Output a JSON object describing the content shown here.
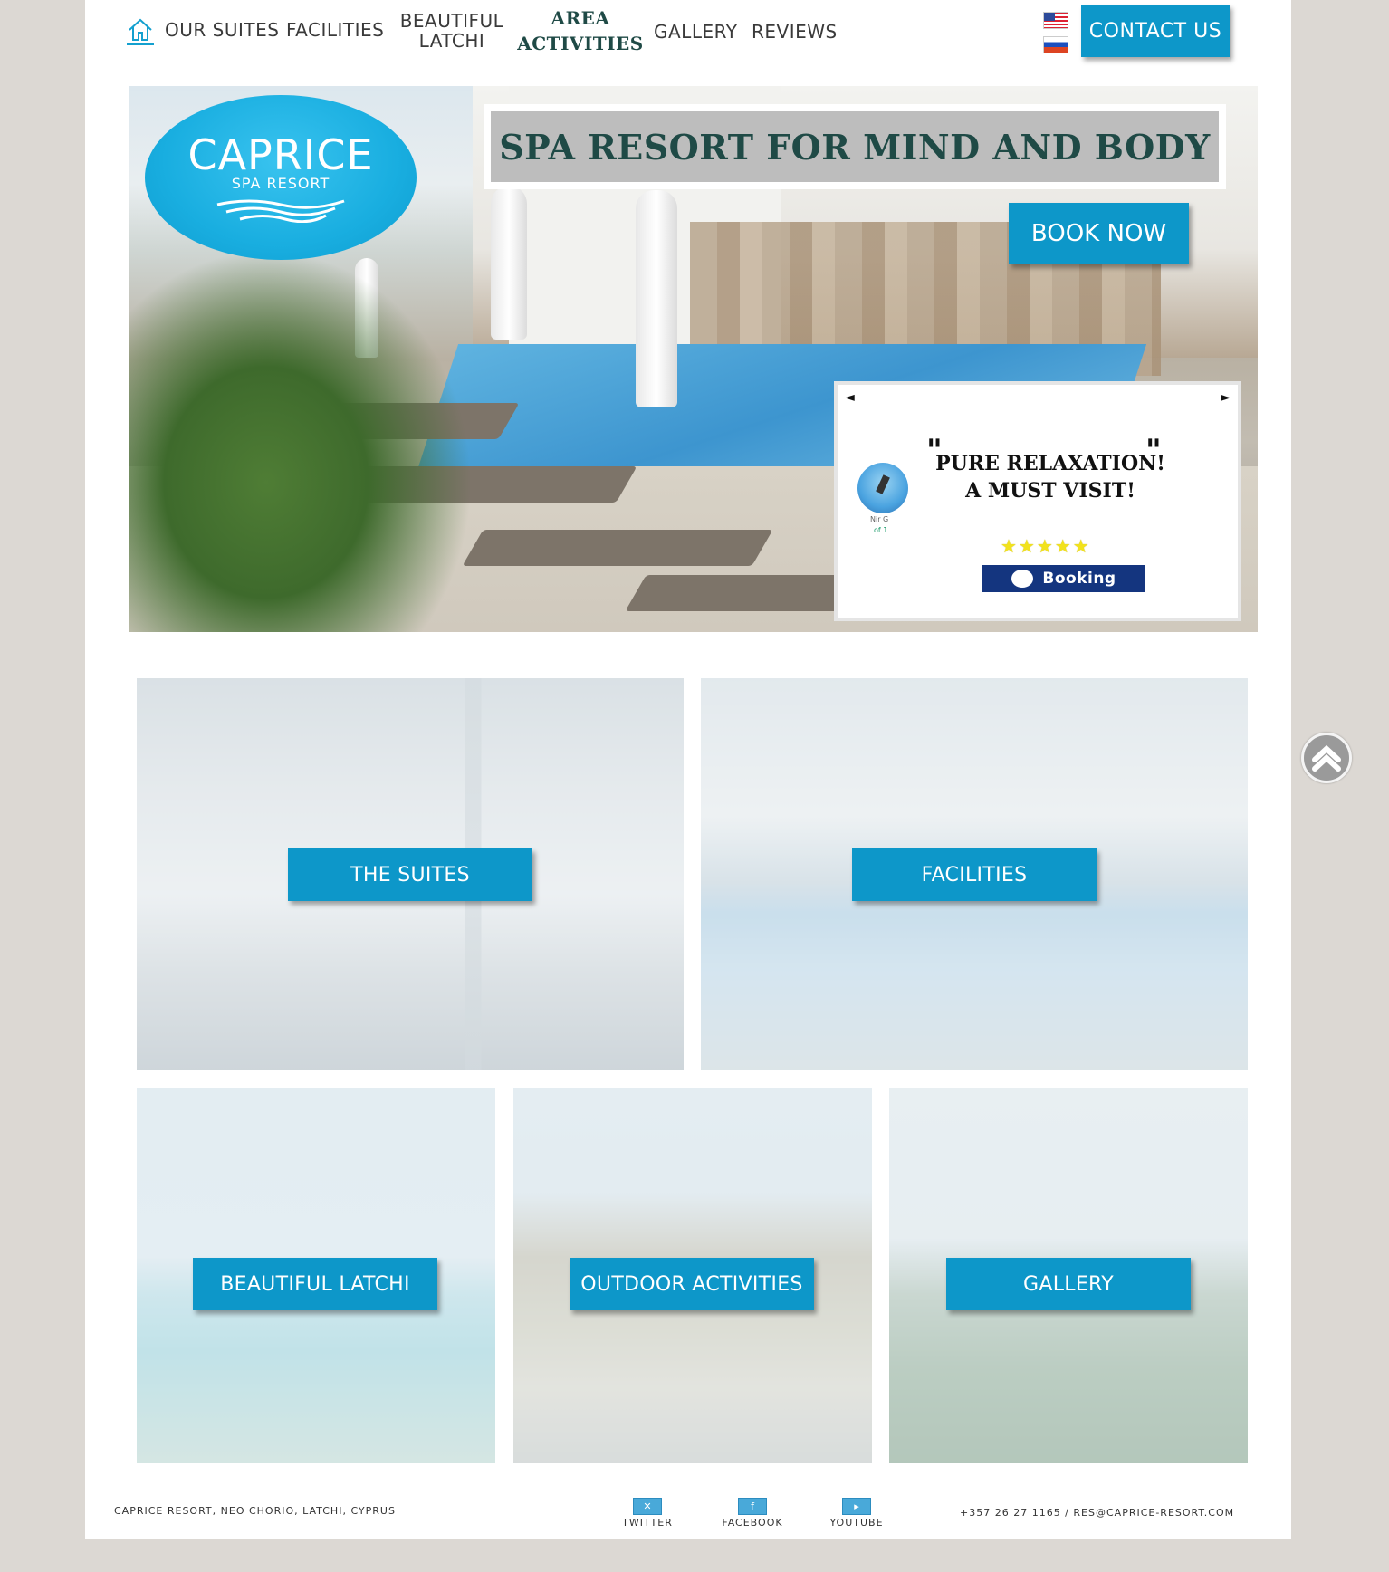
{
  "nav": {
    "home_label": "",
    "items": [
      {
        "label": "OUR SUITES"
      },
      {
        "label": "FACILITIES"
      },
      {
        "label": "BEAUTIFUL LATCHI"
      },
      {
        "label": "AREA ACTIVITIES"
      },
      {
        "label": "GALLERY"
      },
      {
        "label": "REVIEWS"
      }
    ],
    "languages": [
      "us-flag-icon",
      "ru-flag-icon"
    ],
    "contact_label": "CONTACT US"
  },
  "hero": {
    "logo_name": "CAPRICE",
    "logo_sub": "SPA RESORT",
    "tagline": "SPA RESORT FOR MIND AND BODY",
    "book_label": "BOOK NOW",
    "review": {
      "prev_arrow": "◄",
      "next_arrow": "►",
      "reviewer_name": "Nir G",
      "reviewer_count": "of 1",
      "quote_line1": "PURE RELAXATION!",
      "quote_line2": "A MUST VISIT!",
      "rating": 5,
      "stars": "★★★★★",
      "source": "Booking"
    }
  },
  "tiles": {
    "suites": "THE SUITES",
    "facilities": "FACILITIES",
    "latchi": "BEAUTIFUL LATCHI",
    "outdoor": "OUTDOOR ACTIVITIES",
    "gallery": "GALLERY"
  },
  "footer": {
    "address": "CAPRICE RESORT, NEO CHORIO, LATCHI, CYPRUS",
    "social": [
      {
        "label": "TWITTER",
        "icon": "twitter-icon"
      },
      {
        "label": "FACEBOOK",
        "icon": "facebook-icon"
      },
      {
        "label": "YOUTUBE",
        "icon": "youtube-icon"
      }
    ],
    "phone": "+357 26 27 1165 /",
    "email": "RES@CAPRICE-RESORT.COM"
  },
  "colors": {
    "accent": "#0d97c9",
    "heading": "#1f4a46",
    "page_bg": "#dcd8d3"
  }
}
